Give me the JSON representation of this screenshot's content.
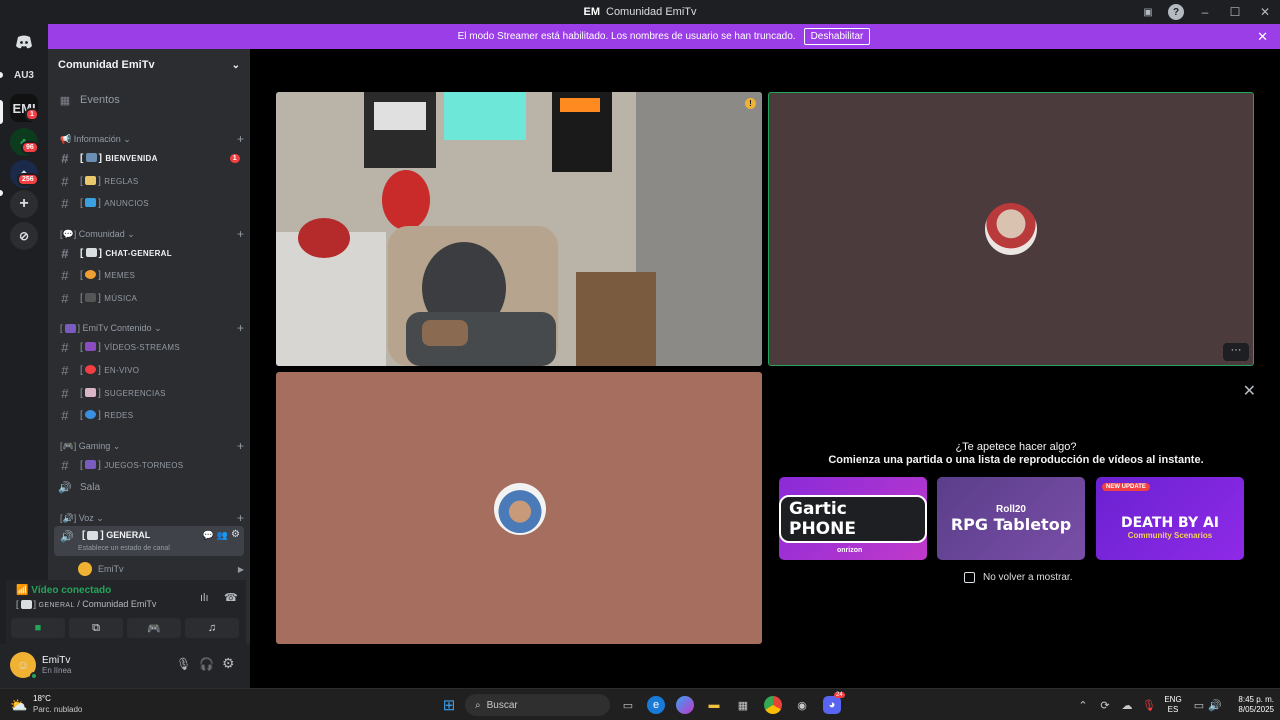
{
  "window": {
    "logo_text": "EM",
    "title": "Comunidad EmiTv"
  },
  "banner": {
    "text": "El modo Streamer está habilitado. Los nombres de usuario se han truncado.",
    "button": "Deshabilitar"
  },
  "rail": {
    "servers": [
      {
        "label": "AU3"
      },
      {
        "label": "EMI",
        "badge": "1"
      },
      {
        "label": "",
        "badge": "96"
      },
      {
        "label": "",
        "badge": "256"
      }
    ]
  },
  "guild": {
    "name": "Comunidad EmiTv"
  },
  "sidebar": {
    "events": "Eventos",
    "cat_info": "Información",
    "ch_bienvenida": "BIENVENIDA",
    "ch_bienvenida_badge": "1",
    "ch_reglas": "REGLAS",
    "ch_anuncios": "ANUNCIOS",
    "cat_comunidad": "Comunidad",
    "ch_chat": "CHAT-GENERAL",
    "ch_memes": "MEMES",
    "ch_musica": "MÚSICA",
    "cat_contenido": "EmiTv Contenido",
    "ch_videos": "VÍDEOS-STREAMS",
    "ch_envivo": "EN-VIVO",
    "ch_sugerencias": "SUGERENCIAS",
    "ch_redes": "REDES",
    "cat_gaming": "Gaming",
    "ch_juegos": "JUEGOS-TORNEOS",
    "ch_sala": "Sala",
    "cat_voz": "Voz",
    "ch_general": "GENERAL",
    "ch_general_status": "Establece un estado de canal",
    "voice_user": "EmiTv"
  },
  "voice": {
    "status": "Vídeo conectado",
    "channel_prefix": "GENERAL",
    "channel_suffix": " / Comunidad EmiTv"
  },
  "user": {
    "name": "EmiTv",
    "status": "En línea"
  },
  "activities": {
    "question": "¿Te apetece hacer algo?",
    "subtitle": "Comienza una partida o una lista de reproducción de vídeos al instante.",
    "cards": [
      {
        "title": "Gartic PHONE",
        "brand": "onrizon"
      },
      {
        "brand": "Roll20",
        "title": "RPG Tabletop"
      },
      {
        "tag": "NEW UPDATE",
        "title": "DEATH BY AI",
        "sub": "Community Scenarios"
      }
    ],
    "dont_show": "No volver a mostrar."
  },
  "taskbar": {
    "weather_temp": "18°C",
    "weather_desc": "Parc. nublado",
    "search": "Buscar",
    "lang_top": "ENG",
    "lang_bottom": "ES",
    "time": "8:45 p. m.",
    "date": "8/05/2025",
    "discord_badge": "24"
  },
  "colors": {
    "accent": "#9b3ee8",
    "online": "#23a559",
    "danger": "#f23f43"
  }
}
